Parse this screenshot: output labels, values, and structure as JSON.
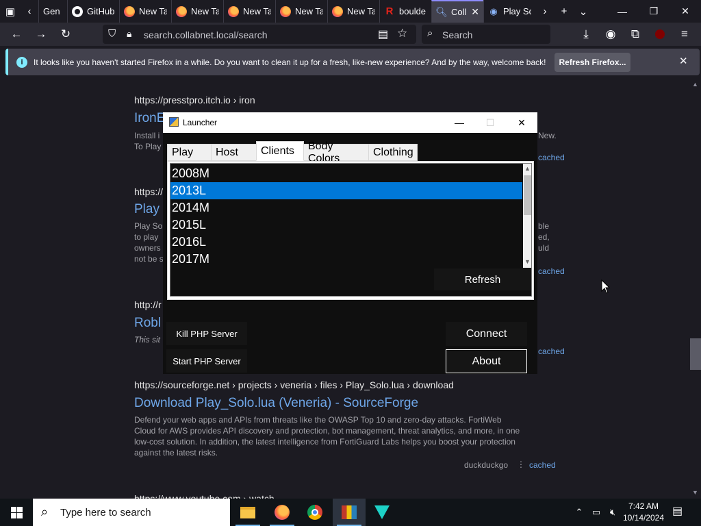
{
  "browser": {
    "tabs": [
      {
        "label": "Gen",
        "icon": "back-tab-icon"
      },
      {
        "label": "GitHub",
        "icon": "github-icon"
      },
      {
        "label": "New Ta",
        "icon": "firefox-icon"
      },
      {
        "label": "New Ta",
        "icon": "firefox-icon"
      },
      {
        "label": "New Ta",
        "icon": "firefox-icon"
      },
      {
        "label": "New Ta",
        "icon": "firefox-icon"
      },
      {
        "label": "New Ta",
        "icon": "firefox-icon"
      },
      {
        "label": "boulde",
        "icon": "roblox-r-icon"
      },
      {
        "label": "Coll",
        "icon": "search-icon"
      },
      {
        "label": "Play So",
        "icon": "eye-icon"
      }
    ],
    "url": "search.collabnet.local/search",
    "search_placeholder": "Search",
    "notification": {
      "message": "It looks like you haven't started Firefox in a while. Do you want to clean it up for a fresh, like-new experience? And by the way, welcome back!",
      "button": "Refresh Firefox..."
    }
  },
  "results": {
    "r1": {
      "crumb": "https://presstpro.itch.io  › iron",
      "title": "IronE",
      "snip1": "Install i",
      "snip2": "To Play",
      "snip_right": "New.",
      "cached": "cached"
    },
    "r2": {
      "crumb": "https://",
      "title": "Play",
      "lines": [
        "Play So",
        "to play",
        "owners",
        "not be s"
      ],
      "right": [
        "ble",
        "ed,",
        "uld"
      ],
      "cached": "cached"
    },
    "r3": {
      "crumb": "http://r",
      "title": "Robl",
      "snip": "This sit",
      "cached": "cached"
    },
    "r4": {
      "crumb": "https://sourceforge.net  › projects › veneria › files › Play_Solo.lua › download",
      "title": "Download Play_Solo.lua (Veneria) - SourceForge",
      "lines": [
        "Defend your web apps and APIs from threats like the OWASP Top 10 and zero-day attacks. FortiWeb",
        "Cloud for AWS provides API discovery and protection, bot management, threat analytics, and more, in one",
        "low-cost solution. In addition, the latest intelligence from FortiGuard Labs helps you boost your protection",
        "against the latest risks."
      ],
      "source": "duckduckgo",
      "cached": "cached"
    },
    "r5": {
      "crumb": "https://www.youtube.com  › watch"
    }
  },
  "launcher": {
    "title": "Launcher",
    "tabs": [
      "Play",
      "Host",
      "Clients",
      "Body Colors",
      "Clothing"
    ],
    "active_tab": "Clients",
    "clients": [
      "2008M",
      "2013L",
      "2014M",
      "2015L",
      "2016L",
      "2017M"
    ],
    "selected_client": "2013L",
    "refresh": "Refresh",
    "kill_php": "Kill PHP Server",
    "start_php": "Start PHP Server",
    "connect": "Connect",
    "about": "About"
  },
  "taskbar": {
    "search_placeholder": "Type here to search",
    "time": "7:42 AM",
    "date": "10/14/2024"
  },
  "colors": {
    "accent": "#0078d7",
    "link": "#6ea6e8",
    "firefox_active_tab": "#8e8cff"
  }
}
